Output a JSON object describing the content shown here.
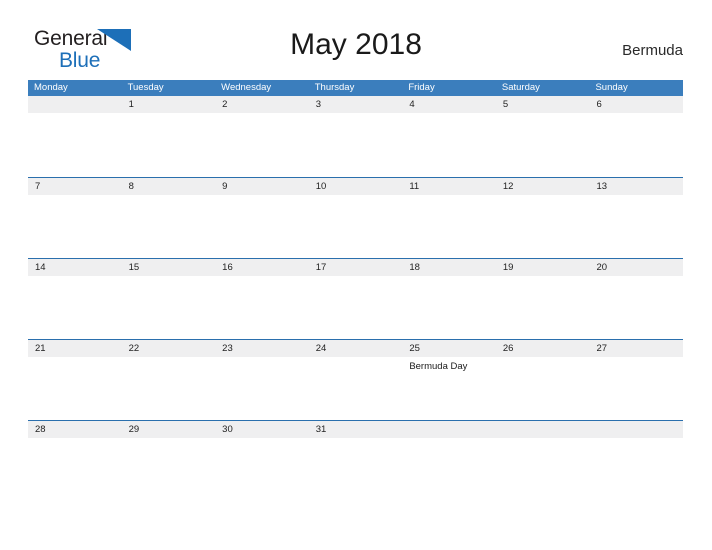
{
  "brand": {
    "line1": "General",
    "line2": "Blue",
    "triangle_icon": "triangle-icon",
    "color_primary": "#1d6fb8",
    "color_text": "#231f20"
  },
  "header": {
    "title": "May 2018",
    "region": "Bermuda"
  },
  "theme": {
    "header_blue": "#3b7ebd",
    "row_divider_blue": "#2a6fad",
    "day_band_gray": "#efeff0",
    "page_background": "#ffffff"
  },
  "calendar": {
    "weekdays": [
      "Monday",
      "Tuesday",
      "Wednesday",
      "Thursday",
      "Friday",
      "Saturday",
      "Sunday"
    ],
    "weeks": [
      {
        "days": [
          {
            "num": "",
            "event": ""
          },
          {
            "num": "1",
            "event": ""
          },
          {
            "num": "2",
            "event": ""
          },
          {
            "num": "3",
            "event": ""
          },
          {
            "num": "4",
            "event": ""
          },
          {
            "num": "5",
            "event": ""
          },
          {
            "num": "6",
            "event": ""
          }
        ]
      },
      {
        "days": [
          {
            "num": "7",
            "event": ""
          },
          {
            "num": "8",
            "event": ""
          },
          {
            "num": "9",
            "event": ""
          },
          {
            "num": "10",
            "event": ""
          },
          {
            "num": "11",
            "event": ""
          },
          {
            "num": "12",
            "event": ""
          },
          {
            "num": "13",
            "event": ""
          }
        ]
      },
      {
        "days": [
          {
            "num": "14",
            "event": ""
          },
          {
            "num": "15",
            "event": ""
          },
          {
            "num": "16",
            "event": ""
          },
          {
            "num": "17",
            "event": ""
          },
          {
            "num": "18",
            "event": ""
          },
          {
            "num": "19",
            "event": ""
          },
          {
            "num": "20",
            "event": ""
          }
        ]
      },
      {
        "days": [
          {
            "num": "21",
            "event": ""
          },
          {
            "num": "22",
            "event": ""
          },
          {
            "num": "23",
            "event": ""
          },
          {
            "num": "24",
            "event": ""
          },
          {
            "num": "25",
            "event": "Bermuda Day"
          },
          {
            "num": "26",
            "event": ""
          },
          {
            "num": "27",
            "event": ""
          }
        ]
      },
      {
        "days": [
          {
            "num": "28",
            "event": ""
          },
          {
            "num": "29",
            "event": ""
          },
          {
            "num": "30",
            "event": ""
          },
          {
            "num": "31",
            "event": ""
          },
          {
            "num": "",
            "event": ""
          },
          {
            "num": "",
            "event": ""
          },
          {
            "num": "",
            "event": ""
          }
        ]
      }
    ]
  }
}
